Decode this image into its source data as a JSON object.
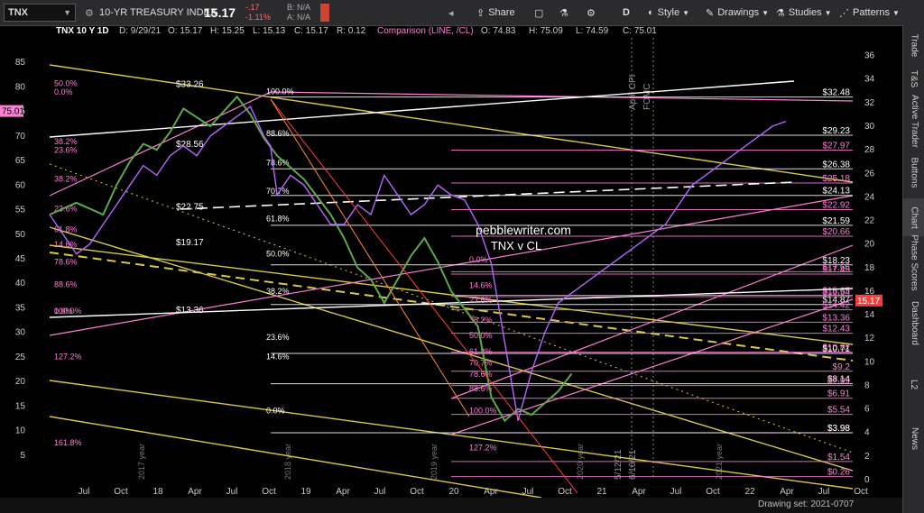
{
  "toolbar": {
    "symbol": "TNX",
    "description": "10-YR TREASURY INDEX",
    "last": "15.17",
    "change": "-.17",
    "change_pct": "-1.11%",
    "bid": "B: N/A",
    "ask": "A: N/A",
    "share_label": "Share",
    "period_label": "D",
    "style_label": "Style",
    "drawings_label": "Drawings",
    "studies_label": "Studies",
    "patterns_label": "Patterns"
  },
  "info": {
    "title": "TNX 10 Y 1D",
    "date": "D: 9/29/21",
    "open": "O: 15.17",
    "high": "H: 15.25",
    "low": "L: 15.13",
    "close": "C: 15.17",
    "range": "R: 0.12",
    "comparison": "Comparison (LINE, /CL)",
    "cmp_open": "O: 74.83",
    "cmp_high": "H: 75.09",
    "cmp_low": "L: 74.59",
    "cmp_close": "C: 75.01"
  },
  "right_panel": [
    "Trade",
    "T&S",
    "Active Trader",
    "Buttons",
    "Chart",
    "Phase Scores",
    "Dashboard",
    "L2",
    "News"
  ],
  "bottom": {
    "drawing_set": "Drawing set: 2021-0707"
  },
  "colors": {
    "accent": "#ff7fd5",
    "tnx": "#5fa84a",
    "cl": "#b566ff",
    "gold": "#d7c94a",
    "white": "#ffffff",
    "orange": "#ff8a2a",
    "red": "#ff3b3b"
  },
  "chart_data": {
    "type": "line",
    "left_axis": {
      "label": "CL",
      "ticks": [
        5,
        10,
        15,
        20,
        25,
        30,
        35,
        40,
        45,
        50,
        55,
        60,
        65,
        70,
        75,
        80,
        85
      ],
      "ylim": [
        0,
        90
      ]
    },
    "right_axis": {
      "label": "TNX",
      "ticks": [
        0,
        2,
        4,
        6,
        8,
        10,
        12,
        14,
        16,
        18,
        20,
        22,
        24,
        26,
        28,
        30,
        32,
        34,
        36
      ],
      "ylim": [
        0,
        37.5
      ]
    },
    "x_axis": {
      "ticks": [
        "Jul",
        "Oct",
        "18",
        "Apr",
        "Jul",
        "Oct",
        "19",
        "Apr",
        "Jul",
        "Oct",
        "20",
        "Apr",
        "Jul",
        "Oct",
        "21",
        "Apr",
        "Jul",
        "Oct",
        "22",
        "Apr",
        "Jul",
        "Oct"
      ]
    },
    "current_values": {
      "cl": "75.01",
      "tnx": "15.17"
    },
    "watermark": [
      "pebblewriter.com",
      "TNX  v  CL"
    ],
    "event_labels": [
      "April CPI",
      "FOMC",
      "5/12/21",
      "6/16/21"
    ],
    "year_labels": [
      "2017 year",
      "2018 year",
      "2019 year",
      "2020 year",
      "2021 year"
    ],
    "fib_labels_left": [
      {
        "label": "50.0%",
        "cl": 80.2
      },
      {
        "label": "0.0%",
        "cl": 78.4
      },
      {
        "label": "38.2%",
        "cl": 68.3
      },
      {
        "label": "23.6%",
        "cl": 66.6
      },
      {
        "label": "38.2%",
        "cl": 60.7
      },
      {
        "label": "23.6%",
        "cl": 54.6
      },
      {
        "label": "61.8%",
        "cl": 50.4
      },
      {
        "label": "14.6%",
        "cl": 47.4
      },
      {
        "label": "78.6%",
        "cl": 43.8
      },
      {
        "label": "88.6%",
        "cl": 39.2
      },
      {
        "label": "0.0%",
        "cl": 33.8
      },
      {
        "label": "100.0%",
        "cl": 33.8
      },
      {
        "label": "127.2%",
        "cl": 24.5
      },
      {
        "label": "161.8%",
        "cl": 7.0
      }
    ],
    "fib_labels_mid": [
      {
        "label": "100.0%",
        "cl": 78.5
      },
      {
        "label": "88.6%",
        "cl": 70.0
      },
      {
        "label": "78.6%",
        "cl": 64.0
      },
      {
        "label": "70.7%",
        "cl": 58.2
      },
      {
        "label": "61.8%",
        "cl": 52.6
      },
      {
        "label": "50.0%",
        "cl": 45.5
      },
      {
        "label": "38.2%",
        "cl": 37.8
      },
      {
        "label": "23.6%",
        "cl": 28.5
      },
      {
        "label": "14.6%",
        "cl": 24.5
      },
      {
        "label": "0.0%",
        "cl": 13.5
      }
    ],
    "fib_labels_covid": [
      {
        "label": "0.0%",
        "cl": 44.3
      },
      {
        "label": "14.6%",
        "cl": 39.0
      },
      {
        "label": "23.6%",
        "cl": 36.0
      },
      {
        "label": "38.2%",
        "cl": 32.0
      },
      {
        "label": "50.0%",
        "cl": 28.8
      },
      {
        "label": "61.8%",
        "cl": 25.5
      },
      {
        "label": "70.7%",
        "cl": 23.2
      },
      {
        "label": "78.6%",
        "cl": 20.9
      },
      {
        "label": "88.6%",
        "cl": 18.0
      },
      {
        "label": "100.0%",
        "cl": 13.5
      },
      {
        "label": "127.2%",
        "cl": 6.0
      }
    ],
    "price_labels_left": [
      {
        "label": "$33.26",
        "cl": 80.0
      },
      {
        "label": "$28.56",
        "cl": 67.8
      },
      {
        "label": "$22.75",
        "cl": 55.0
      },
      {
        "label": "$19.17",
        "cl": 47.8
      },
      {
        "label": "$13.36",
        "cl": 34.0
      }
    ],
    "price_levels_right": [
      {
        "label": "$32.48",
        "tnx": 32.48,
        "color": "#ffffff"
      },
      {
        "label": "$29.23",
        "tnx": 29.23,
        "color": "#ffffff"
      },
      {
        "label": "$27.97",
        "tnx": 27.97,
        "color": "#ff7fd5"
      },
      {
        "label": "$26.38",
        "tnx": 26.38,
        "color": "#ffffff"
      },
      {
        "label": "$25.18",
        "tnx": 25.18,
        "color": "#ff7fd5"
      },
      {
        "label": "$24.13",
        "tnx": 24.13,
        "color": "#ffffff"
      },
      {
        "label": "$22.92",
        "tnx": 22.92,
        "color": "#ff7fd5"
      },
      {
        "label": "$21.59",
        "tnx": 21.59,
        "color": "#ffffff"
      },
      {
        "label": "$20.66",
        "tnx": 20.66,
        "color": "#ff7fd5"
      },
      {
        "label": "$18.23",
        "tnx": 18.23,
        "color": "#ffffff"
      },
      {
        "label": "$17.65",
        "tnx": 17.65,
        "color": "#ff7fd5"
      },
      {
        "label": "$17.45",
        "tnx": 17.45,
        "color": "#ff7fd5"
      },
      {
        "label": "$15.65",
        "tnx": 15.65,
        "color": "#ff7fd5"
      },
      {
        "label": "$15.54",
        "tnx": 15.54,
        "color": "#ff7fd5"
      },
      {
        "label": "$14.87",
        "tnx": 14.87,
        "color": "#ffffff"
      },
      {
        "label": "$14.42",
        "tnx": 14.42,
        "color": "#ff7fd5"
      },
      {
        "label": "$13.36",
        "tnx": 13.36,
        "color": "#ff7fd5"
      },
      {
        "label": "$12.43",
        "tnx": 12.43,
        "color": "#ff7fd5"
      },
      {
        "label": "$10.82",
        "tnx": 10.82,
        "color": "#ff7fd5"
      },
      {
        "label": "$10.71",
        "tnx": 10.71,
        "color": "#ffffff"
      },
      {
        "label": "$9.2",
        "tnx": 9.2,
        "color": "#ff7fd5"
      },
      {
        "label": "$8.14",
        "tnx": 8.14,
        "color": "#ffffff"
      },
      {
        "label": "$7.99",
        "tnx": 7.99,
        "color": "#ff7fd5"
      },
      {
        "label": "$6.91",
        "tnx": 6.91,
        "color": "#ff7fd5"
      },
      {
        "label": "$5.54",
        "tnx": 5.54,
        "color": "#ff7fd5"
      },
      {
        "label": "$3.98",
        "tnx": 3.98,
        "color": "#ff7fd5"
      },
      {
        "label": "$3.98",
        "tnx": 3.98,
        "color": "#ffffff"
      },
      {
        "label": "$1.54",
        "tnx": 1.54,
        "color": "#ff7fd5"
      },
      {
        "label": "$0.26",
        "tnx": 0.26,
        "color": "#ff7fd5"
      }
    ],
    "series": [
      {
        "name": "TNX",
        "color": "#5fa84a",
        "x": [
          0,
          4,
          8,
          10,
          12,
          14,
          16,
          18,
          20,
          24,
          28,
          30,
          32,
          34,
          36,
          38,
          40,
          42,
          44,
          46,
          48,
          50,
          52,
          54,
          56,
          58,
          60,
          62,
          64,
          66,
          68,
          70,
          72,
          74,
          76,
          78
        ],
        "tnx": [
          22.5,
          23.5,
          22.5,
          25,
          27,
          28.5,
          28,
          29.5,
          31.5,
          30,
          32.5,
          31,
          29,
          27.5,
          26.5,
          25.5,
          24,
          22.5,
          20.5,
          18,
          17,
          15,
          17,
          19,
          20.5,
          18.5,
          16,
          14.5,
          13,
          7,
          5,
          6,
          5.5,
          6.5,
          7.5,
          9
        ]
      },
      {
        "name": "/CL",
        "color": "#b566ff",
        "x": [
          0,
          2,
          4,
          6,
          8,
          10,
          12,
          14,
          16,
          18,
          20,
          22,
          24,
          26,
          28,
          30,
          32,
          33,
          34,
          36,
          38,
          40,
          42,
          44,
          46,
          48,
          50,
          52,
          54,
          56,
          58,
          60,
          62,
          64,
          66,
          68,
          70,
          72,
          74,
          76,
          78,
          80,
          82,
          84,
          86,
          88,
          90,
          92,
          94,
          96,
          98,
          100,
          102,
          104,
          106,
          108,
          110
        ],
        "cl": [
          54,
          50,
          46,
          48,
          52,
          56,
          60,
          64,
          62,
          66,
          68,
          66,
          70,
          72,
          74,
          76,
          70,
          68,
          58,
          62,
          60,
          56,
          52,
          52,
          56,
          54,
          62,
          58,
          54,
          56,
          60,
          58,
          57,
          52,
          44,
          28,
          12,
          22,
          30,
          36,
          38,
          40,
          42,
          44,
          46,
          48,
          50,
          52,
          56,
          60,
          62,
          64,
          66,
          68,
          70,
          72,
          73
        ]
      }
    ]
  }
}
